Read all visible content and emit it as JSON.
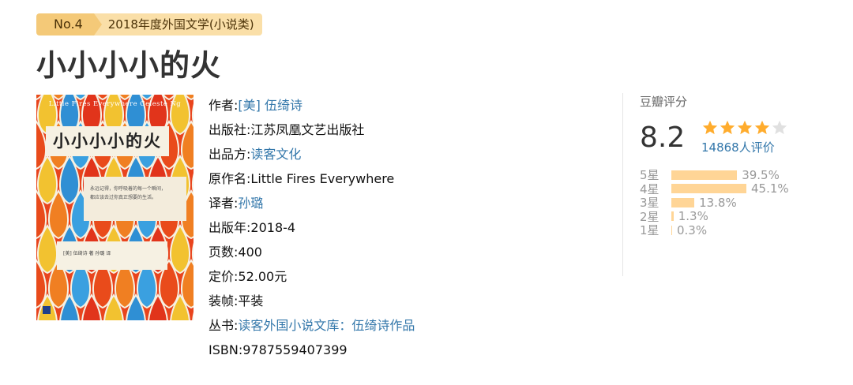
{
  "rank": {
    "number": "No.4",
    "list_name": "2018年度外国文学(小说类)"
  },
  "book": {
    "title": "小小小小的火",
    "cover": {
      "top_text": "Little Fires Everywhere Celeste Ng",
      "title": "小小小小的火",
      "quote_line1": "永远记得，你呼吸着的每一个瞬间，",
      "quote_line2": "都应该去过你真正想要的生活。",
      "authors": "[美] 伍绮诗 著   孙璐 译"
    },
    "info": [
      {
        "label": "作者: ",
        "value": "[美] 伍绮诗",
        "link": true
      },
      {
        "label": "出版社: ",
        "value": "江苏凤凰文艺出版社",
        "link": false
      },
      {
        "label": "出品方: ",
        "value": "读客文化",
        "link": true
      },
      {
        "label": "原作名: ",
        "value": "Little Fires Everywhere",
        "link": false
      },
      {
        "label": "译者: ",
        "value": "孙璐",
        "link": true
      },
      {
        "label": "出版年: ",
        "value": "2018-4",
        "link": false
      },
      {
        "label": "页数: ",
        "value": "400",
        "link": false
      },
      {
        "label": "定价: ",
        "value": "52.00元",
        "link": false
      },
      {
        "label": "装帧: ",
        "value": "平装",
        "link": false
      },
      {
        "label": "丛书: ",
        "value": "读客外国小说文库：伍绮诗作品",
        "link": true
      },
      {
        "label": "ISBN: ",
        "value": "9787559407399",
        "link": false
      }
    ]
  },
  "rating": {
    "title": "豆瓣评分",
    "score": "8.2",
    "stars": 4,
    "stars_max": 5,
    "votes": "14868人评价",
    "distribution": [
      {
        "label": "5星",
        "pct_text": "39.5%",
        "pct": 39.5
      },
      {
        "label": "4星",
        "pct_text": "45.1%",
        "pct": 45.1
      },
      {
        "label": "3星",
        "pct_text": "13.8%",
        "pct": 13.8
      },
      {
        "label": "2星",
        "pct_text": "1.3%",
        "pct": 1.3
      },
      {
        "label": "1星",
        "pct_text": "0.3%",
        "pct": 0.3
      }
    ]
  },
  "colors": {
    "link": "#3377aa",
    "star": "#ffac2d",
    "star_empty": "#e0e0e0",
    "bar": "#ffd596",
    "badge_dark": "#f4c978",
    "badge_light": "#fadfa8"
  }
}
